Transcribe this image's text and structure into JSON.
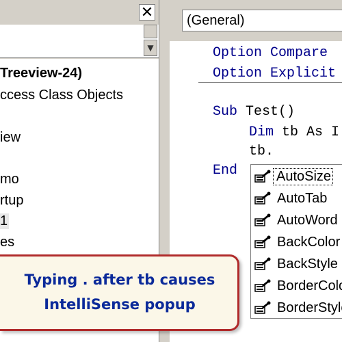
{
  "project_explorer": {
    "close_glyph": "✕",
    "scroll_down_glyph": "▼",
    "tree_items": [
      {
        "label": "Treeview-24)",
        "bold": true
      },
      {
        "label": "ccess Class Objects",
        "bold": false
      },
      {
        "label": "iew",
        "bold": false
      },
      {
        "label": "mo",
        "bold": false
      },
      {
        "label": "rtup",
        "bold": false
      },
      {
        "label": "1",
        "bold": false,
        "selected": true
      },
      {
        "label": "es",
        "bold": false
      }
    ]
  },
  "code_window": {
    "object_dropdown": "(General)",
    "lines": [
      {
        "kw": "Option Compare",
        "rest": ""
      },
      {
        "kw": "Option Explicit",
        "rest": ""
      },
      {
        "kw": "Sub ",
        "rest": "Test()"
      },
      {
        "kw": "Dim ",
        "rest": "tb As I"
      },
      {
        "kw": "",
        "rest": "tb."
      },
      {
        "kw": "End",
        "rest": ""
      }
    ]
  },
  "intellisense": {
    "icon": "property-icon",
    "items": [
      "AutoSize",
      "AutoTab",
      "AutoWord",
      "BackColor",
      "BackStyle",
      "BorderColor",
      "BorderStyle"
    ]
  },
  "callout": {
    "line1": "Typing . after tb causes",
    "line2": "IntelliSense popup"
  },
  "colors": {
    "keyword": "#00008b",
    "callout_border": "#b02a2a",
    "callout_text": "#0b2a9a"
  }
}
